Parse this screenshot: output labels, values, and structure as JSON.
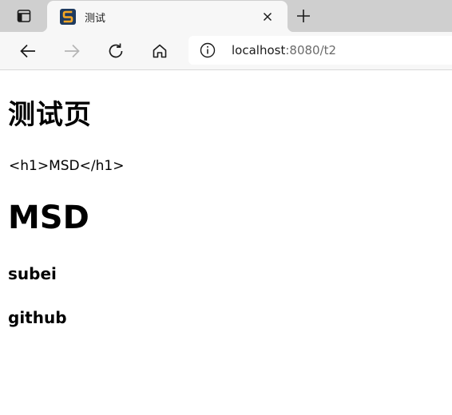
{
  "browser": {
    "tab": {
      "title": "测试",
      "favicon_letter": "S"
    },
    "address": {
      "host": "localhost",
      "rest": ":8080/t2"
    }
  },
  "page": {
    "heading_cn": "测试页",
    "escaped_line": "<h1>MSD</h1>",
    "heading_msd": "MSD",
    "h3_subei": "subei",
    "h3_github": "github"
  },
  "icons": {
    "tab_actions": "tab-actions-icon",
    "close": "close-icon",
    "new_tab": "plus-icon",
    "back": "back-arrow-icon",
    "forward": "forward-arrow-icon",
    "refresh": "refresh-icon",
    "home": "home-icon",
    "info": "info-icon"
  },
  "colors": {
    "tabstrip": "#cfcfcf",
    "toolbar": "#f7f7f7",
    "favicon_bg": "#1e3a5f",
    "favicon_fg": "#f5a623"
  }
}
